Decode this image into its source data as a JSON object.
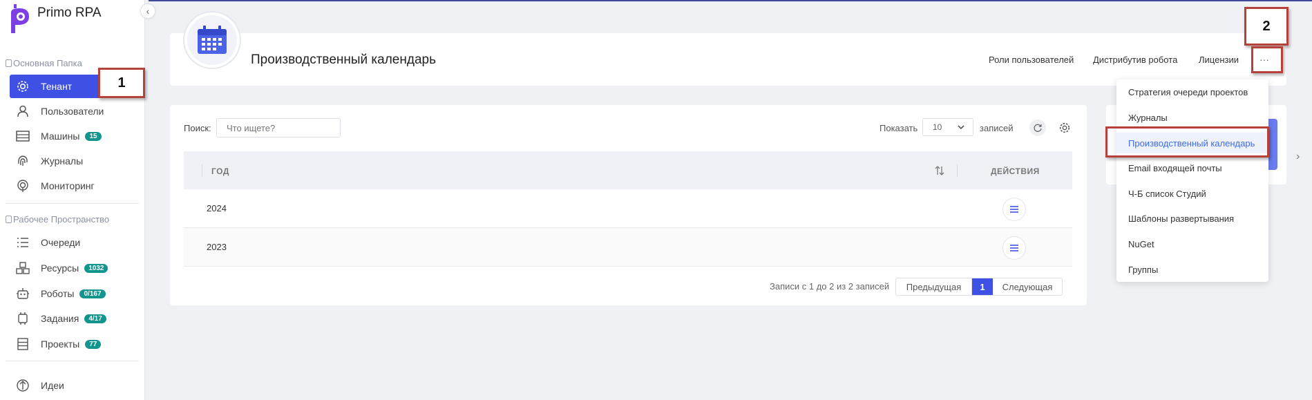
{
  "app": {
    "name": "Primo RPA"
  },
  "sidebar": {
    "section1_title": "Основная Папка",
    "section2_title": "Рабочее Пространство",
    "items": [
      {
        "label": "Тенант",
        "icon": "gear-icon",
        "active": true
      },
      {
        "label": "Пользователи",
        "icon": "user-icon"
      },
      {
        "label": "Машины",
        "icon": "server-icon",
        "badge": "15"
      },
      {
        "label": "Журналы",
        "icon": "fingerprint-icon"
      },
      {
        "label": "Мониторинг",
        "icon": "monitoring-icon"
      },
      {
        "label": "Очереди",
        "icon": "list-icon"
      },
      {
        "label": "Ресурсы",
        "icon": "resources-icon",
        "badge": "1032"
      },
      {
        "label": "Роботы",
        "icon": "robot-icon",
        "badge": "0/167"
      },
      {
        "label": "Задания",
        "icon": "tasks-icon",
        "badge": "4/17"
      },
      {
        "label": "Проекты",
        "icon": "projects-icon",
        "badge": "77"
      },
      {
        "label": "Идеи",
        "icon": "ideas-icon"
      }
    ]
  },
  "header": {
    "title": "Производственный календарь",
    "links": [
      "Роли пользователей",
      "Дистрибутив робота",
      "Лицензии"
    ],
    "more_label": "···"
  },
  "toolbar": {
    "search_label": "Поиск:",
    "search_placeholder": "Что ищете?",
    "show_label": "Показать",
    "page_size": "10",
    "records_label": "записей"
  },
  "table": {
    "columns": [
      "ГОД",
      "ДЕЙСТВИЯ"
    ],
    "rows": [
      {
        "year": "2024"
      },
      {
        "year": "2023"
      }
    ]
  },
  "footer": {
    "info": "Записи с 1 до 2 из 2 записей",
    "prev": "Предыдущая",
    "page": "1",
    "next": "Следующая"
  },
  "dropdown": {
    "items": [
      "Стратегия очереди проектов",
      "Журналы",
      "Производственный календарь",
      "Email входящей почты",
      "Ч-Б список Студий",
      "Шаблоны развертывания",
      "NuGet",
      "Группы"
    ],
    "active_index": 2
  },
  "annotations": {
    "one": "1",
    "two": "2"
  },
  "colors": {
    "accent": "#3f51e4",
    "badge": "#11958e",
    "annotation": "#b5423a"
  }
}
